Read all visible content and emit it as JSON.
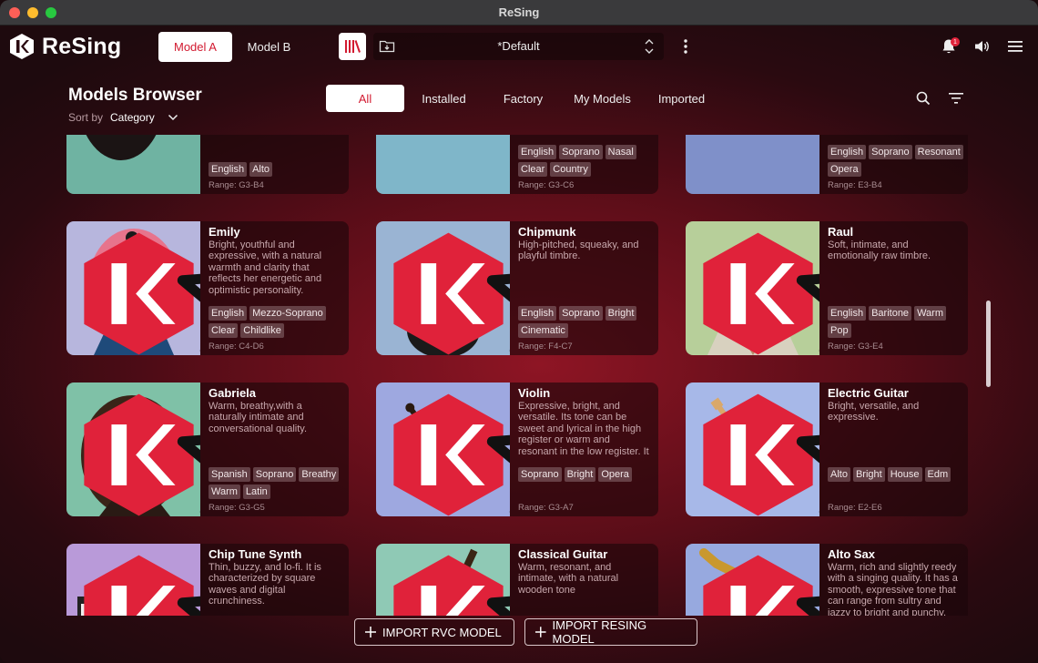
{
  "window": {
    "title": "ReSing"
  },
  "header": {
    "app_name": "ReSing",
    "model_tabs": [
      {
        "label": "Model A",
        "active": true
      },
      {
        "label": "Model B",
        "active": false
      }
    ],
    "preset": {
      "name": "*Default"
    },
    "notification_count": "1"
  },
  "browser": {
    "title": "Models Browser",
    "sort_label": "Sort by",
    "sort_value": "Category",
    "filter_tabs": [
      {
        "label": "All",
        "active": true
      },
      {
        "label": "Installed",
        "active": false
      },
      {
        "label": "Factory",
        "active": false
      },
      {
        "label": "My Models",
        "active": false
      },
      {
        "label": "Imported",
        "active": false
      }
    ]
  },
  "models": [
    {
      "name": "",
      "description": "",
      "tags": [
        "English",
        "Alto"
      ],
      "range": "Range: G3-B4",
      "image": "woman-dark-hair"
    },
    {
      "name": "",
      "description": "",
      "tags": [
        "English",
        "Soprano",
        "Nasal",
        "Clear",
        "Country"
      ],
      "range": "Range: G3-C6",
      "image": "woman-blonde"
    },
    {
      "name": "",
      "description": "",
      "tags": [
        "English",
        "Soprano",
        "Resonant",
        "Opera"
      ],
      "range": "Range: E3-B4",
      "image": "woman-pendant"
    },
    {
      "name": "Emily",
      "description": "Bright, youthful and expressive, with a natural warmth and clarity that reflects her energetic and optimistic personality.",
      "tags": [
        "English",
        "Mezzo-Soprano",
        "Clear",
        "Childlike"
      ],
      "range": "Range: C4-D6",
      "image": "anime-girl"
    },
    {
      "name": "Chipmunk",
      "description": "High-pitched, squeaky, and playful timbre.",
      "tags": [
        "English",
        "Soprano",
        "Bright",
        "Cinematic"
      ],
      "range": "Range: F4-C7",
      "image": "chipmunk"
    },
    {
      "name": "Raul",
      "description": "Soft, intimate, and emotionally raw timbre.",
      "tags": [
        "English",
        "Baritone",
        "Warm",
        "Pop"
      ],
      "range": "Range: G3-E4",
      "image": "man-curly"
    },
    {
      "name": "Gabriela",
      "description": "Warm, breathy,with a naturally intimate and conversational quality.",
      "tags": [
        "Spanish",
        "Soprano",
        "Breathy",
        "Warm",
        "Latin"
      ],
      "range": "Range: G3-G5",
      "image": "woman-curly"
    },
    {
      "name": "Violin",
      "description": "Expressive, bright, and versatile. Its tone can be sweet and lyrical in the high register or warm and resonant in the low register. It is highly emotive ...",
      "tags": [
        "Soprano",
        "Bright",
        "Opera"
      ],
      "range": "Range: G3-A7",
      "image": "violin"
    },
    {
      "name": "Electric Guitar",
      "description": "Bright, versatile, and expressive.",
      "tags": [
        "Alto",
        "Bright",
        "House",
        "Edm"
      ],
      "range": "Range: E2-E6",
      "image": "electric-guitar"
    },
    {
      "name": "Chip Tune Synth",
      "description": "Thin, buzzy, and lo-fi. It is  characterized by square waves and digital crunchiness.",
      "tags": [],
      "range": "",
      "image": "synth"
    },
    {
      "name": "Classical Guitar",
      "description": "Warm, resonant, and intimate, with a natural wooden tone",
      "tags": [],
      "range": "",
      "image": "classical-guitar"
    },
    {
      "name": "Alto Sax",
      "description": "Warm, rich and slightly reedy with a singing quality. It has a smooth, expressive tone that can range from sultry and jazzy to bright and punchy.",
      "tags": [],
      "range": "",
      "image": "saxophone"
    }
  ],
  "actions": {
    "import_rvc": "IMPORT RVC MODEL",
    "import_resing": "IMPORT RESING MODEL"
  },
  "colors": {
    "accent": "#d21a30",
    "bg_center": "#8e1524",
    "bg_edge": "#1e0a0e"
  }
}
